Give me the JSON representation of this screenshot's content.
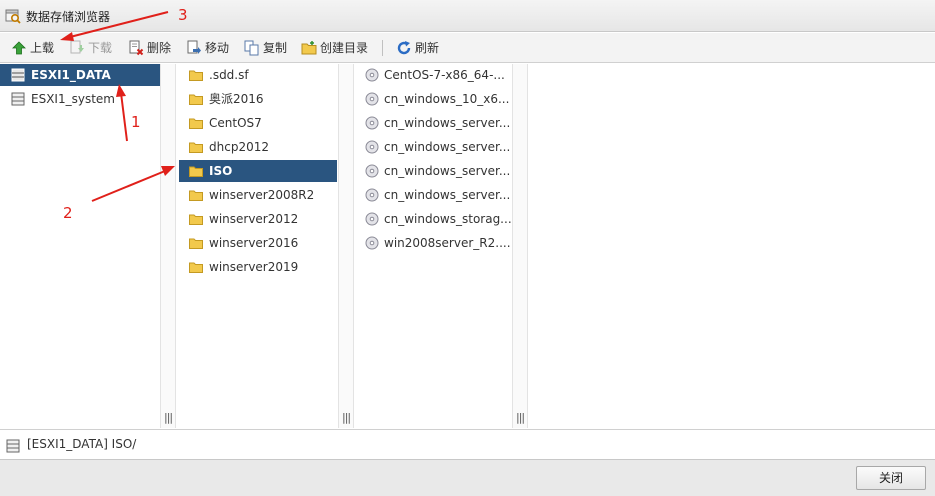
{
  "window": {
    "title": "数据存储浏览器"
  },
  "toolbar": {
    "upload": "上载",
    "download": "下载",
    "delete": "删除",
    "move": "移动",
    "copy": "复制",
    "create_dir": "创建目录",
    "refresh": "刷新"
  },
  "datastores": [
    {
      "name": "ESXI1_DATA",
      "selected": true
    },
    {
      "name": "ESXI1_system",
      "selected": false
    }
  ],
  "folders": [
    ".sdd.sf",
    "奥派2016",
    "CentOS7",
    "dhcp2012",
    "ISO",
    "winserver2008R2",
    "winserver2012",
    "winserver2016",
    "winserver2019"
  ],
  "selected_folder": "ISO",
  "files": [
    "CentOS-7-x86_64-...",
    "cn_windows_10_x6...",
    "cn_windows_server...",
    "cn_windows_server...",
    "cn_windows_server...",
    "cn_windows_server...",
    "cn_windows_storag...",
    "win2008server_R2...."
  ],
  "grip_label": "|||",
  "status": {
    "path": "[ESXI1_DATA] ISO/"
  },
  "footer": {
    "close": "关闭"
  },
  "annotations": [
    "1",
    "2",
    "3"
  ],
  "colors": {
    "selection": "#2a5580",
    "annotation": "#e0201a",
    "folder": "#f2c94c"
  }
}
